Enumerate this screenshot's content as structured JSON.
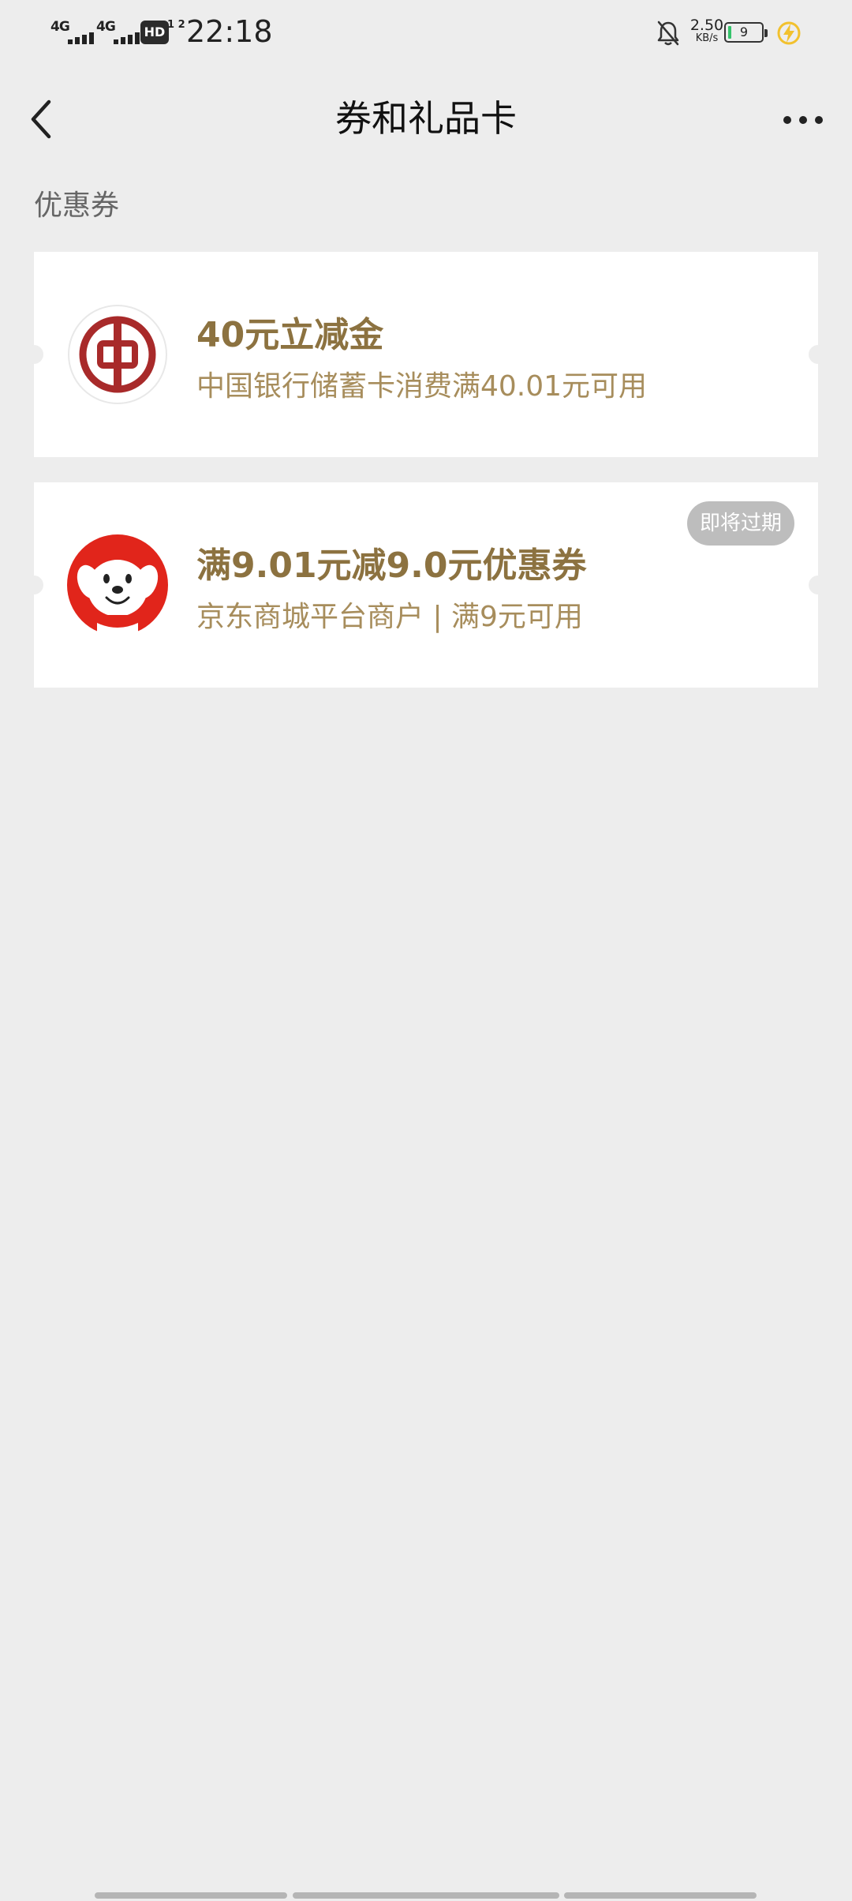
{
  "status_bar": {
    "sim1": "4G",
    "sim2": "4G",
    "hd_label": "HD",
    "hd_sub": "1 2",
    "time": "22:18",
    "speed_value": "2.50",
    "speed_unit": "KB/s",
    "battery_level": "9",
    "battery_fraction": 0.09,
    "icons": [
      "signal-bars-icon",
      "hd-voice-icon",
      "mute-bell-icon",
      "battery-icon",
      "charging-bolt-icon"
    ]
  },
  "nav": {
    "title": "券和礼品卡",
    "back_icon": "chevron-left-icon",
    "more_icon": "more-dots-icon"
  },
  "section": {
    "title": "优惠券"
  },
  "coupons": [
    {
      "title": "40元立减金",
      "desc": "中国银行储蓄卡消费满40.01元可用",
      "logo": "bank-of-china-logo",
      "badge": ""
    },
    {
      "title": "满9.01元减9.0元优惠券",
      "desc": "京东商城平台商户 | 满9元可用",
      "logo": "jd-mascot-logo",
      "badge": "即将过期"
    }
  ],
  "colors": {
    "background": "#ededed",
    "card": "#ffffff",
    "coupon_title": "#8c7240",
    "coupon_desc": "#a78d5c",
    "badge_bg": "#bdbdbd",
    "boc_red": "#a82a2a",
    "jd_red": "#e1251b"
  }
}
